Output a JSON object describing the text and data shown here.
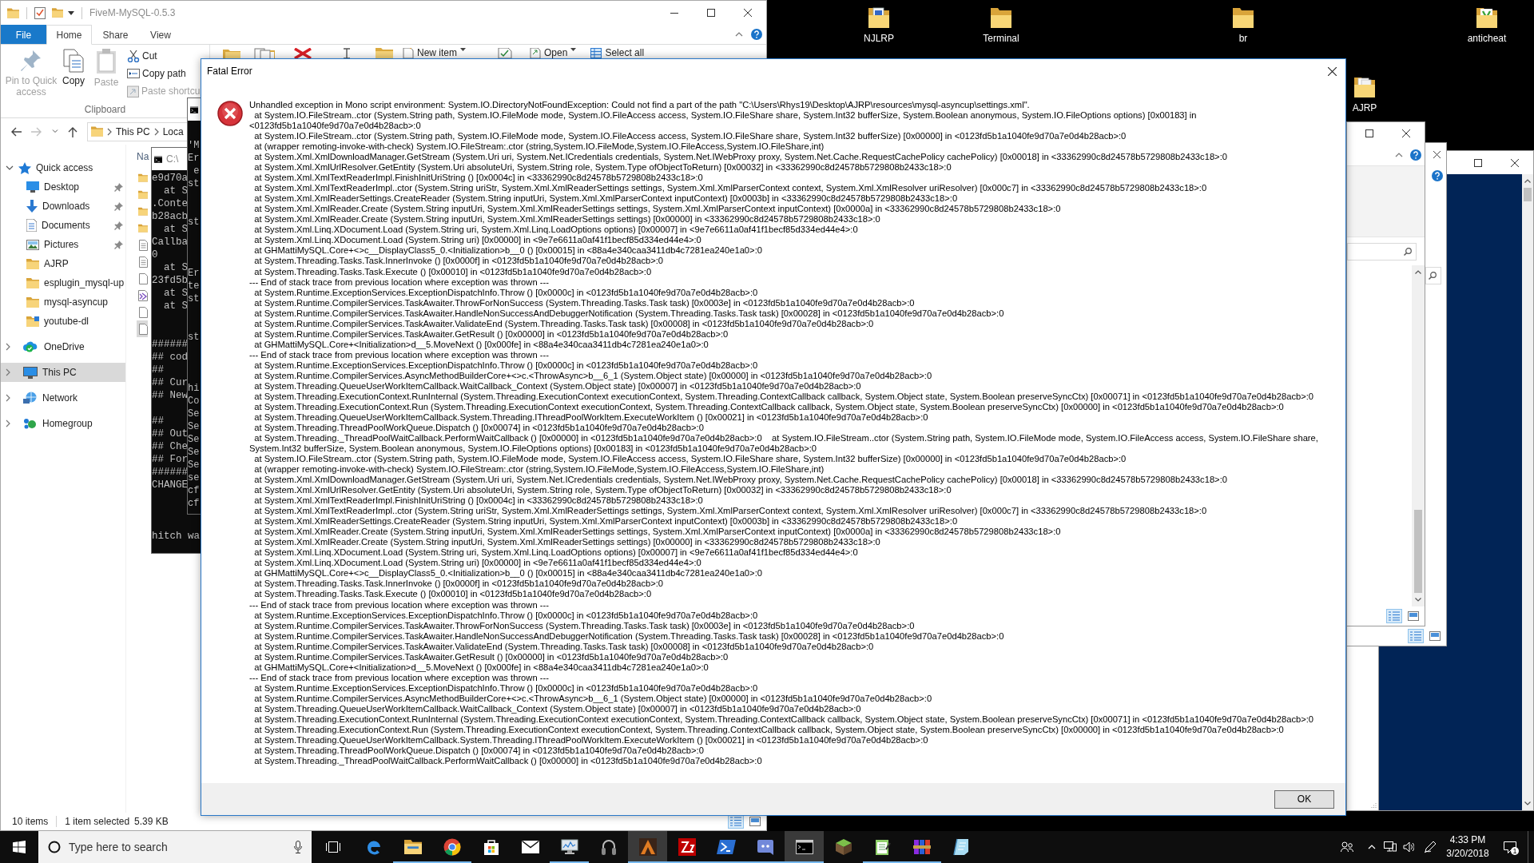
{
  "desktop_icons": [
    {
      "label": "NJLRP",
      "kind": "folder-document"
    },
    {
      "label": "Terminal",
      "kind": "folder"
    },
    {
      "label": "br",
      "kind": "folder"
    },
    {
      "label": "anticheat",
      "kind": "folder-app"
    },
    {
      "label": "AJRP",
      "kind": "folder-files"
    }
  ],
  "explorer": {
    "title": "FiveM-MySQL-0.5.3",
    "tabs": [
      {
        "label": "File",
        "kind": "menu",
        "selected": false
      },
      {
        "label": "Home",
        "kind": "tab",
        "selected": true
      },
      {
        "label": "Share",
        "kind": "tab",
        "selected": false
      },
      {
        "label": "View",
        "kind": "tab",
        "selected": false
      }
    ],
    "clipboard": {
      "large_buttons": [
        {
          "label": "Pin to Quick access",
          "kind": "pin",
          "disabled": true
        },
        {
          "label": "Copy",
          "kind": "copy",
          "disabled": false
        },
        {
          "label": "Paste",
          "kind": "paste",
          "disabled": true
        }
      ],
      "small_buttons": [
        {
          "label": "Cut",
          "kind": "cut",
          "disabled": false
        },
        {
          "label": "Copy path",
          "kind": "copy-path",
          "disabled": false
        },
        {
          "label": "Paste shortcu",
          "kind": "paste-shortcut",
          "disabled": true
        }
      ],
      "label": "Clipboard"
    },
    "ribbon_items": [
      {
        "label": "New item",
        "kind": "new-item",
        "dropdown": true
      },
      {
        "label": "Open",
        "kind": "open",
        "dropdown": true
      },
      {
        "label": "Select all",
        "kind": "select-all",
        "dropdown": false
      }
    ],
    "address": [
      "This PC",
      "Loca"
    ],
    "navigation": [
      {
        "label": "Quick access",
        "kind": "star",
        "expanded": true,
        "selected": false,
        "children": [
          {
            "label": "Desktop",
            "kind": "desktop",
            "pinned": true,
            "selected": false
          },
          {
            "label": "Downloads",
            "kind": "downloads",
            "pinned": true,
            "selected": false
          },
          {
            "label": "Documents",
            "kind": "documents",
            "pinned": true,
            "selected": false
          },
          {
            "label": "Pictures",
            "kind": "pictures",
            "pinned": true,
            "selected": false
          },
          {
            "label": "AJRP",
            "kind": "folder",
            "pinned": false,
            "selected": false
          },
          {
            "label": "esplugin_mysql-up",
            "kind": "folder",
            "pinned": false,
            "selected": false
          },
          {
            "label": "mysql-asyncup",
            "kind": "folder",
            "pinned": false,
            "selected": false
          },
          {
            "label": "youtube-dl",
            "kind": "folder-badge",
            "pinned": false,
            "selected": false
          }
        ]
      },
      {
        "label": "OneDrive",
        "kind": "cloud",
        "expanded": false,
        "selected": false
      },
      {
        "label": "This PC",
        "kind": "computer",
        "expanded": false,
        "selected": true
      },
      {
        "label": "Network",
        "kind": "network",
        "expanded": false,
        "selected": false
      },
      {
        "label": "Homegroup",
        "kind": "homegroup",
        "expanded": false,
        "selected": false
      }
    ],
    "file_list": {
      "column": "Na",
      "rows": [
        {
          "kind": "folder",
          "selected": false
        },
        {
          "kind": "folder",
          "selected": false
        },
        {
          "kind": "folder",
          "selected": false
        },
        {
          "kind": "folder",
          "selected": false
        },
        {
          "kind": "text",
          "selected": false
        },
        {
          "kind": "text",
          "selected": false
        },
        {
          "kind": "blank",
          "selected": false
        },
        {
          "kind": "solution",
          "selected": false
        },
        {
          "kind": "blank",
          "selected": false
        },
        {
          "kind": "blank",
          "selected": true
        }
      ]
    },
    "status_bar": {
      "items": "10 items",
      "selection": "1 item selected",
      "size": "5.39 KB"
    },
    "view_buttons": [
      {
        "kind": "details",
        "selected": true
      },
      {
        "kind": "thumbnails",
        "selected": false
      }
    ]
  },
  "consoles": [
    {
      "title": "C:\\",
      "blocks": [
        "e9d70a\n  at S\n.Conte\nb28acb\n  at S\nCallba\n0\n  at S\n23fd5b\n  at S\n  at S\n\n\n######\n## cod\n##\n## Cur\n## New\n\n##\n## Out\n## Che\n## For\n######\nCHANGE",
        "hitch wa"
      ]
    },
    {
      "blocks": [
        "'M\nEr\n e\nst\n\n\nst\n\n\n\nEr\nte\nst\n\n\nst\n\n\n\nhi\nCo\nSe\nSe\nSe\nSe\nSe\nse\ncf\ncf"
      ]
    }
  ],
  "background_windows": [
    {
      "kind": "console"
    },
    {
      "kind": "plain"
    },
    {
      "kind": "explorer-strip",
      "view_buttons": [
        {
          "kind": "details",
          "selected": true
        },
        {
          "kind": "thumbnails",
          "selected": false
        }
      ]
    },
    {
      "kind": "explorer",
      "view_buttons": [
        {
          "kind": "details",
          "selected": true
        },
        {
          "kind": "thumbnails",
          "selected": false
        }
      ]
    }
  ],
  "dialog": {
    "title": "Fatal Error",
    "message": "Unhandled exception in Mono script environment: System.IO.DirectoryNotFoundException: Could not find a part of the path \"C:\\Users\\Rhys19\\Desktop\\AJRP\\resources\\mysql-asyncup\\settings.xml\".",
    "trace": [
      "  at System.IO.FileStream..ctor (System.String path, System.IO.FileMode mode, System.IO.FileAccess access, System.IO.FileShare share, System.Int32 bufferSize, System.Boolean anonymous, System.IO.FileOptions options) [0x00183] in",
      "<0123fd5b1a1040fe9d70a7e0d4b28acb>:0",
      "  at System.IO.FileStream..ctor (System.String path, System.IO.FileMode mode, System.IO.FileAccess access, System.IO.FileShare share, System.Int32 bufferSize) [0x00000] in <0123fd5b1a1040fe9d70a7e0d4b28acb>:0",
      "  at (wrapper remoting-invoke-with-check) System.IO.FileStream:.ctor (string,System.IO.FileMode,System.IO.FileAccess,System.IO.FileShare,int)",
      "  at System.Xml.XmlDownloadManager.GetStream (System.Uri uri, System.Net.ICredentials credentials, System.Net.IWebProxy proxy, System.Net.Cache.RequestCachePolicy cachePolicy) [0x00018] in <33362990c8d24578b5729808b2433c18>:0",
      "  at System.Xml.XmlUrlResolver.GetEntity (System.Uri absoluteUri, System.String role, System.Type ofObjectToReturn) [0x00032] in <33362990c8d24578b5729808b2433c18>:0",
      "  at System.Xml.XmlTextReaderImpl.FinishInitUriString () [0x0004c] in <33362990c8d24578b5729808b2433c18>:0",
      "  at System.Xml.XmlTextReaderImpl..ctor (System.String uriStr, System.Xml.XmlReaderSettings settings, System.Xml.XmlParserContext context, System.Xml.XmlResolver uriResolver) [0x000c7] in <33362990c8d24578b5729808b2433c18>:0",
      "  at System.Xml.XmlReaderSettings.CreateReader (System.String inputUri, System.Xml.XmlParserContext inputContext) [0x0003b] in <33362990c8d24578b5729808b2433c18>:0",
      "  at System.Xml.XmlReader.Create (System.String inputUri, System.Xml.XmlReaderSettings settings, System.Xml.XmlParserContext inputContext) [0x0000a] in <33362990c8d24578b5729808b2433c18>:0",
      "  at System.Xml.XmlReader.Create (System.String inputUri, System.Xml.XmlReaderSettings settings) [0x00000] in <33362990c8d24578b5729808b2433c18>:0",
      "  at System.Xml.Linq.XDocument.Load (System.String uri, System.Xml.Linq.LoadOptions options) [0x00007] in <9e7e6611a0af41f1becf85d334ed44e4>:0",
      "  at System.Xml.Linq.XDocument.Load (System.String uri) [0x00000] in <9e7e6611a0af41f1becf85d334ed44e4>:0",
      "  at GHMattiMySQL.Core+<>c__DisplayClass5_0.<Initialization>b__0 () [0x00015] in <88a4e340caa3411db4c7281ea240e1a0>:0",
      "  at System.Threading.Tasks.Task.InnerInvoke () [0x0000f] in <0123fd5b1a1040fe9d70a7e0d4b28acb>:0",
      "  at System.Threading.Tasks.Task.Execute () [0x00010] in <0123fd5b1a1040fe9d70a7e0d4b28acb>:0",
      "--- End of stack trace from previous location where exception was thrown ---",
      "  at System.Runtime.ExceptionServices.ExceptionDispatchInfo.Throw () [0x0000c] in <0123fd5b1a1040fe9d70a7e0d4b28acb>:0",
      "  at System.Runtime.CompilerServices.TaskAwaiter.ThrowForNonSuccess (System.Threading.Tasks.Task task) [0x0003e] in <0123fd5b1a1040fe9d70a7e0d4b28acb>:0",
      "  at System.Runtime.CompilerServices.TaskAwaiter.HandleNonSuccessAndDebuggerNotification (System.Threading.Tasks.Task task) [0x00028] in <0123fd5b1a1040fe9d70a7e0d4b28acb>:0",
      "  at System.Runtime.CompilerServices.TaskAwaiter.ValidateEnd (System.Threading.Tasks.Task task) [0x00008] in <0123fd5b1a1040fe9d70a7e0d4b28acb>:0",
      "  at System.Runtime.CompilerServices.TaskAwaiter.GetResult () [0x00000] in <0123fd5b1a1040fe9d70a7e0d4b28acb>:0",
      "  at GHMattiMySQL.Core+<Initialization>d__5.MoveNext () [0x000fe] in <88a4e340caa3411db4c7281ea240e1a0>:0",
      "--- End of stack trace from previous location where exception was thrown ---",
      "  at System.Runtime.ExceptionServices.ExceptionDispatchInfo.Throw () [0x0000c] in <0123fd5b1a1040fe9d70a7e0d4b28acb>:0",
      "  at System.Runtime.CompilerServices.AsyncMethodBuilderCore+<>c.<ThrowAsync>b__6_1 (System.Object state) [0x00000] in <0123fd5b1a1040fe9d70a7e0d4b28acb>:0",
      "  at System.Threading.QueueUserWorkItemCallback.WaitCallback_Context (System.Object state) [0x00007] in <0123fd5b1a1040fe9d70a7e0d4b28acb>:0",
      "  at System.Threading.ExecutionContext.RunInternal (System.Threading.ExecutionContext executionContext, System.Threading.ContextCallback callback, System.Object state, System.Boolean preserveSyncCtx) [0x00071] in <0123fd5b1a1040fe9d70a7e0d4b28acb>:0",
      "  at System.Threading.ExecutionContext.Run (System.Threading.ExecutionContext executionContext, System.Threading.ContextCallback callback, System.Object state, System.Boolean preserveSyncCtx) [0x00000] in <0123fd5b1a1040fe9d70a7e0d4b28acb>:0",
      "  at System.Threading.QueueUserWorkItemCallback.System.Threading.IThreadPoolWorkItem.ExecuteWorkItem () [0x00021] in <0123fd5b1a1040fe9d70a7e0d4b28acb>:0",
      "  at System.Threading.ThreadPoolWorkQueue.Dispatch () [0x00074] in <0123fd5b1a1040fe9d70a7e0d4b28acb>:0",
      "  at System.Threading._ThreadPoolWaitCallback.PerformWaitCallback () [0x00000] in <0123fd5b1a1040fe9d70a7e0d4b28acb>:0    at System.IO.FileStream..ctor (System.String path, System.IO.FileMode mode, System.IO.FileAccess access, System.IO.FileShare share,",
      "System.Int32 bufferSize, System.Boolean anonymous, System.IO.FileOptions options) [0x00183] in <0123fd5b1a1040fe9d70a7e0d4b28acb>:0",
      "  at System.IO.FileStream..ctor (System.String path, System.IO.FileMode mode, System.IO.FileAccess access, System.IO.FileShare share, System.Int32 bufferSize) [0x00000] in <0123fd5b1a1040fe9d70a7e0d4b28acb>:0",
      "  at (wrapper remoting-invoke-with-check) System.IO.FileStream:.ctor (string,System.IO.FileMode,System.IO.FileAccess,System.IO.FileShare,int)",
      "  at System.Xml.XmlDownloadManager.GetStream (System.Uri uri, System.Net.ICredentials credentials, System.Net.IWebProxy proxy, System.Net.Cache.RequestCachePolicy cachePolicy) [0x00018] in <33362990c8d24578b5729808b2433c18>:0",
      "  at System.Xml.XmlUrlResolver.GetEntity (System.Uri absoluteUri, System.String role, System.Type ofObjectToReturn) [0x00032] in <33362990c8d24578b5729808b2433c18>:0",
      "  at System.Xml.XmlTextReaderImpl.FinishInitUriString () [0x0004c] in <33362990c8d24578b5729808b2433c18>:0",
      "  at System.Xml.XmlTextReaderImpl..ctor (System.String uriStr, System.Xml.XmlReaderSettings settings, System.Xml.XmlParserContext context, System.Xml.XmlResolver uriResolver) [0x000c7] in <33362990c8d24578b5729808b2433c18>:0",
      "  at System.Xml.XmlReaderSettings.CreateReader (System.String inputUri, System.Xml.XmlParserContext inputContext) [0x0003b] in <33362990c8d24578b5729808b2433c18>:0",
      "  at System.Xml.XmlReader.Create (System.String inputUri, System.Xml.XmlReaderSettings settings, System.Xml.XmlParserContext inputContext) [0x0000a] in <33362990c8d24578b5729808b2433c18>:0",
      "  at System.Xml.XmlReader.Create (System.String inputUri, System.Xml.XmlReaderSettings settings) [0x00000] in <33362990c8d24578b5729808b2433c18>:0",
      "  at System.Xml.Linq.XDocument.Load (System.String uri, System.Xml.Linq.LoadOptions options) [0x00007] in <9e7e6611a0af41f1becf85d334ed44e4>:0",
      "  at System.Xml.Linq.XDocument.Load (System.String uri) [0x00000] in <9e7e6611a0af41f1becf85d334ed44e4>:0",
      "  at GHMattiMySQL.Core+<>c__DisplayClass5_0.<Initialization>b__0 () [0x00015] in <88a4e340caa3411db4c7281ea240e1a0>:0",
      "  at System.Threading.Tasks.Task.InnerInvoke () [0x0000f] in <0123fd5b1a1040fe9d70a7e0d4b28acb>:0",
      "  at System.Threading.Tasks.Task.Execute () [0x00010] in <0123fd5b1a1040fe9d70a7e0d4b28acb>:0",
      "--- End of stack trace from previous location where exception was thrown ---",
      "  at System.Runtime.ExceptionServices.ExceptionDispatchInfo.Throw () [0x0000c] in <0123fd5b1a1040fe9d70a7e0d4b28acb>:0",
      "  at System.Runtime.CompilerServices.TaskAwaiter.ThrowForNonSuccess (System.Threading.Tasks.Task task) [0x0003e] in <0123fd5b1a1040fe9d70a7e0d4b28acb>:0",
      "  at System.Runtime.CompilerServices.TaskAwaiter.HandleNonSuccessAndDebuggerNotification (System.Threading.Tasks.Task task) [0x00028] in <0123fd5b1a1040fe9d70a7e0d4b28acb>:0",
      "  at System.Runtime.CompilerServices.TaskAwaiter.ValidateEnd (System.Threading.Tasks.Task task) [0x00008] in <0123fd5b1a1040fe9d70a7e0d4b28acb>:0",
      "  at System.Runtime.CompilerServices.TaskAwaiter.GetResult () [0x00000] in <0123fd5b1a1040fe9d70a7e0d4b28acb>:0",
      "  at GHMattiMySQL.Core+<Initialization>d__5.MoveNext () [0x000fe] in <88a4e340caa3411db4c7281ea240e1a0>:0",
      "--- End of stack trace from previous location where exception was thrown ---",
      "  at System.Runtime.ExceptionServices.ExceptionDispatchInfo.Throw () [0x0000c] in <0123fd5b1a1040fe9d70a7e0d4b28acb>:0",
      "  at System.Runtime.CompilerServices.AsyncMethodBuilderCore+<>c.<ThrowAsync>b__6_1 (System.Object state) [0x00000] in <0123fd5b1a1040fe9d70a7e0d4b28acb>:0",
      "  at System.Threading.QueueUserWorkItemCallback.WaitCallback_Context (System.Object state) [0x00007] in <0123fd5b1a1040fe9d70a7e0d4b28acb>:0",
      "  at System.Threading.ExecutionContext.RunInternal (System.Threading.ExecutionContext executionContext, System.Threading.ContextCallback callback, System.Object state, System.Boolean preserveSyncCtx) [0x00071] in <0123fd5b1a1040fe9d70a7e0d4b28acb>:0",
      "  at System.Threading.ExecutionContext.Run (System.Threading.ExecutionContext executionContext, System.Threading.ContextCallback callback, System.Object state, System.Boolean preserveSyncCtx) [0x00000] in <0123fd5b1a1040fe9d70a7e0d4b28acb>:0",
      "  at System.Threading.QueueUserWorkItemCallback.System.Threading.IThreadPoolWorkItem.ExecuteWorkItem () [0x00021] in <0123fd5b1a1040fe9d70a7e0d4b28acb>:0",
      "  at System.Threading.ThreadPoolWorkQueue.Dispatch () [0x00074] in <0123fd5b1a1040fe9d70a7e0d4b28acb>:0",
      "  at System.Threading._ThreadPoolWaitCallback.PerformWaitCallback () [0x00000] in <0123fd5b1a1040fe9d70a7e0d4b28acb>:0"
    ],
    "button": "OK"
  },
  "taskbar": {
    "search_placeholder": "Type here to search",
    "apps": [
      {
        "kind": "edge",
        "open": false,
        "active": false
      },
      {
        "kind": "explorer",
        "open": true,
        "active": false
      },
      {
        "kind": "chrome",
        "open": true,
        "active": false
      },
      {
        "kind": "store",
        "open": false,
        "active": false
      },
      {
        "kind": "mail",
        "open": false,
        "active": false
      },
      {
        "kind": "monitor-chart",
        "open": true,
        "active": false
      },
      {
        "kind": "headphones",
        "open": false,
        "active": false
      },
      {
        "kind": "launcher",
        "open": true,
        "active": true
      },
      {
        "kind": "filezilla",
        "open": true,
        "active": false
      },
      {
        "kind": "powershell",
        "open": true,
        "active": false
      },
      {
        "kind": "discord",
        "open": true,
        "active": false
      },
      {
        "kind": "console",
        "open": true,
        "active": true
      },
      {
        "kind": "cube",
        "open": false,
        "active": false
      },
      {
        "kind": "notepad",
        "open": true,
        "active": false
      },
      {
        "kind": "archive",
        "open": true,
        "active": false
      },
      {
        "kind": "notebook",
        "open": false,
        "active": false
      }
    ],
    "time": "4:33 PM",
    "date": "3/20/2018",
    "notifications": "1"
  }
}
